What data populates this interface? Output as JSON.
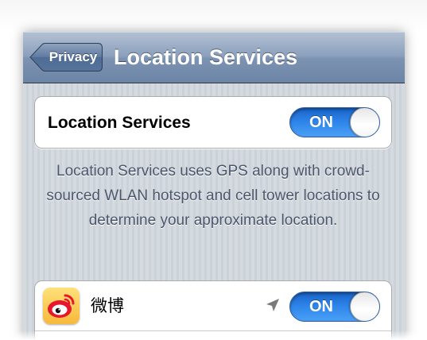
{
  "navbar": {
    "back_label": "Privacy",
    "title": "Location Services"
  },
  "location_services": {
    "label": "Location Services",
    "toggle_label": "ON",
    "enabled": true
  },
  "footer": {
    "description": "Location Services uses GPS along with crowd-sourced WLAN hotspot and cell tower locations to determine your approximate location."
  },
  "apps": [
    {
      "name": "微博",
      "icon": "weibo-icon",
      "location_indicator": "location-arrow-icon",
      "toggle_label": "ON",
      "enabled": true
    }
  ],
  "colors": {
    "navbar": "#7d93b2",
    "toggle_on": "#2f86ea",
    "footer_text": "#4c566c",
    "app_icon_bg": "#f6b93a"
  }
}
